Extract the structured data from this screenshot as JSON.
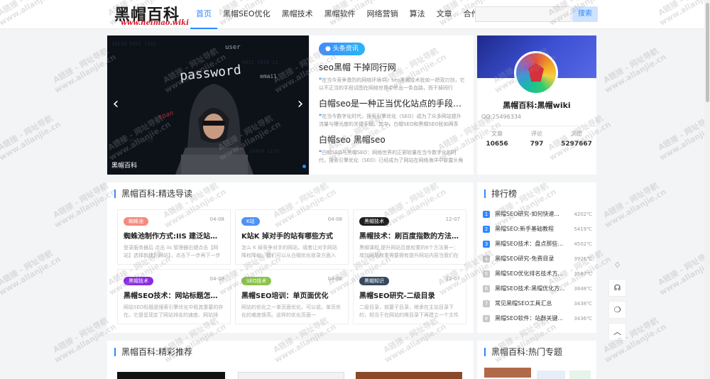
{
  "header": {
    "logo_main": "黑帽百科",
    "logo_sub": "www.heimao.wiki",
    "nav": [
      "首页",
      "黑帽SEO优化",
      "黑帽技术",
      "黑帽软件",
      "网络营销",
      "算法",
      "文章",
      "合作"
    ],
    "search_placeholder": "",
    "search_button": "搜索"
  },
  "slider": {
    "caption": "黑帽百科",
    "prev": "‹",
    "next": "›",
    "image_words": [
      "user",
      "password",
      "email",
      "span"
    ]
  },
  "headlines": {
    "badge": "头条资讯",
    "items": [
      {
        "title": "seo黑帽 干掉同行网",
        "desc": "在当今竞争激烈的网络环境中，seo黑帽技术犹如一把双刃剑，它以不正当的手段试图在网络世界中杀出一条血路，而干掉同行"
      },
      {
        "title": "白帽seo是一种正当优化站点的手段（...",
        "desc": "在当今数字化时代，搜索引擎优化（SEO）成为了众多网站提升流量与曝光度的关键手段。其中，白帽SEO和黑帽SEO犹如两条"
      },
      {
        "title": "白帽seo 黑帽seo",
        "desc": "白帽SEO与黑帽SEO：网络世界的正邪较量在当今数字化的时代，搜索引擎优化（SEO）已经成为了网站在网络海洋中崭露头角"
      }
    ]
  },
  "profile": {
    "name": "黑帽百科:黑帽wiki",
    "qq": "QQ:25496334",
    "stats": [
      {
        "label": "文章",
        "value": "10656"
      },
      {
        "label": "评论",
        "value": "797"
      },
      {
        "label": "浏览",
        "value": "5297667"
      }
    ]
  },
  "featured": {
    "title": "黑帽百科:精选导读",
    "cards": [
      {
        "tag": "蜘蛛池",
        "tag_color": "#f48a7f",
        "date": "04-08",
        "title": "蜘蛛池制作方式:IIS 建泛站群编...",
        "desc": "登录服务器后 点击 iis 管理器右键点击【网站】选择新建】网站】，点击下一步再下一步"
      },
      {
        "tag": "K站",
        "tag_color": "#4f92f5",
        "date": "04-08",
        "title": "K站K 掉对手的站有哪些方式",
        "desc": "怎么 K 掉竞争对手的网站，或者让对手网站降权降权。我们可以从白帽优化收录方面入"
      },
      {
        "tag": "黑帽技术",
        "tag_color": "#1e1e1e",
        "date": "12-07",
        "title": "黑帽技术：刷百度指数的方法提...",
        "desc": "黑帽课程,提升网站百度权重的6个方法第一：增加网站权重需要拥有提升网站内容当我们在建设网"
      },
      {
        "tag": "黑帽技术",
        "tag_color": "#8a2be2",
        "date": "04-08",
        "title": "黑帽SEO技术：网站标题怎么...",
        "desc": "网站SEO标题是搜索引擎优化中极其重要的存在。它是呈现定了网站排名的速度、网站排"
      },
      {
        "tag": "SEO技术",
        "tag_color": "#8bc34a",
        "date": "04-08",
        "title": "黑帽SEO培训：单页面优化",
        "desc": "网站的优化之一单页面优化，可以说，单页优化的难度很高。这样的优化页面一"
      },
      {
        "tag": "黑帽知识",
        "tag_color": "#34495e",
        "date": "12-07",
        "title": "黑帽SEO研究-二级目录",
        "desc": "二级目录，就要子目录，继承在主站目录下的，相当于在网站的根目录下再建立一个文件"
      }
    ]
  },
  "ranking": {
    "title": "排行榜",
    "items": [
      {
        "rank": "1",
        "title": "黑帽SEO研究-如何快速...",
        "temp": "4202℃"
      },
      {
        "rank": "2",
        "title": "黑帽SEO:新手基础教程",
        "temp": "5419℃"
      },
      {
        "rank": "3",
        "title": "黑帽SEO技术：盘点那些...",
        "temp": "4502℃"
      },
      {
        "rank": "4",
        "title": "黑帽SEO研究-免费目录",
        "temp": "3926℃"
      },
      {
        "rank": "5",
        "title": "黑帽SEO优化排名技术方...",
        "temp": "3587℃"
      },
      {
        "rank": "6",
        "title": "黑帽SEO技术:黑帽优化方...",
        "temp": "3848℃"
      },
      {
        "rank": "7",
        "title": "常见黑帽SEO工具汇总",
        "temp": "3438℃"
      },
      {
        "rank": "8",
        "title": "黑帽SEO软件：站群关键...",
        "temp": "3436℃"
      }
    ]
  },
  "recommend": {
    "title": "黑帽百科:精彩推荐"
  },
  "topics": {
    "title": "黑帽百科:热门专题"
  },
  "float_tools": [
    {
      "name": "lightbulb-icon",
      "glyph": "♢"
    },
    {
      "name": "headset-icon",
      "glyph": "☊"
    },
    {
      "name": "wechat-icon",
      "glyph": "❍"
    },
    {
      "name": "back-to-top-icon",
      "glyph": "︿"
    }
  ],
  "watermark": {
    "line1": "A链接 - 网址导航",
    "line2": "www.allanjie.cn"
  },
  "colors": {
    "accent": "#2f88ff",
    "rank_top": "#2f88ff",
    "rank_other": "#c7c7c7"
  }
}
